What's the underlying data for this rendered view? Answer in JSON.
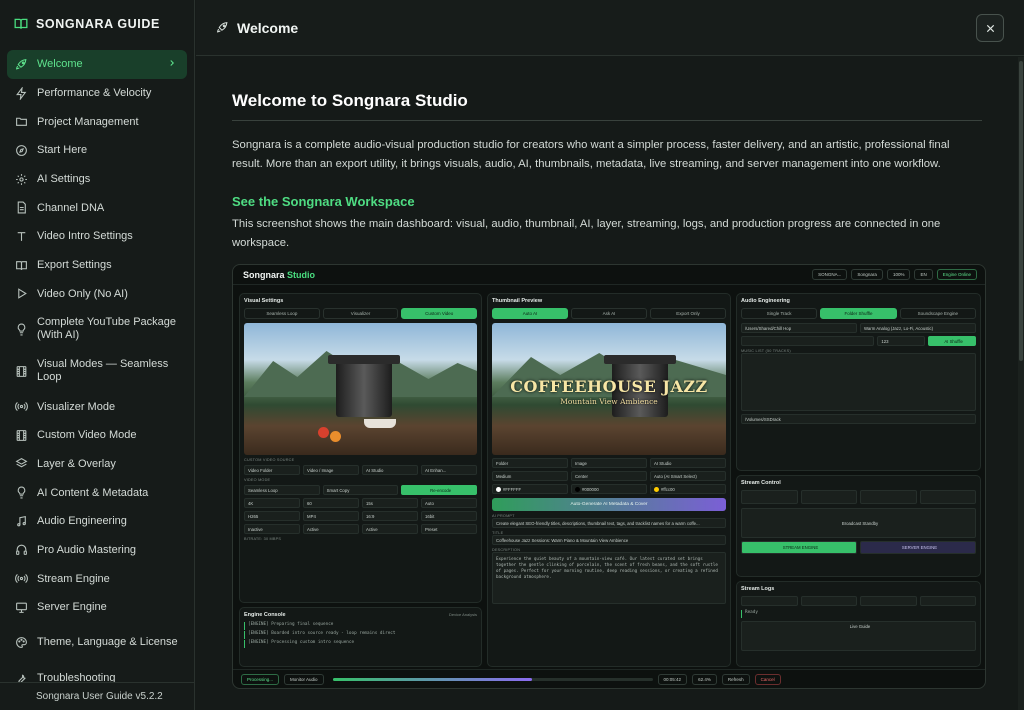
{
  "brand": {
    "title": "SONGNARA GUIDE"
  },
  "nav": [
    {
      "label": "Welcome",
      "icon": "rocket-icon",
      "active": true
    },
    {
      "label": "Performance & Velocity",
      "icon": "bolt-icon"
    },
    {
      "label": "Project Management",
      "icon": "folder-icon"
    },
    {
      "label": "Start Here",
      "icon": "compass-icon"
    },
    {
      "label": "AI Settings",
      "icon": "gear-icon"
    },
    {
      "label": "Channel DNA",
      "icon": "document-icon"
    },
    {
      "label": "Video Intro Settings",
      "icon": "text-icon"
    },
    {
      "label": "Export Settings",
      "icon": "book-icon"
    },
    {
      "label": "Video Only (No AI)",
      "icon": "play-icon"
    },
    {
      "label": "Complete YouTube Package (With AI)",
      "icon": "lightbulb-icon"
    },
    {
      "label": "Visual Modes — Seamless Loop",
      "icon": "film-icon"
    },
    {
      "label": "Visualizer Mode",
      "icon": "radio-icon"
    },
    {
      "label": "Custom Video Mode",
      "icon": "film-icon"
    },
    {
      "label": "Layer & Overlay",
      "icon": "layers-icon"
    },
    {
      "label": "AI Content & Metadata",
      "icon": "lightbulb-icon"
    },
    {
      "label": "Audio Engineering",
      "icon": "music-icon"
    },
    {
      "label": "Pro Audio Mastering",
      "icon": "headphones-icon"
    },
    {
      "label": "Stream Engine",
      "icon": "radio-icon"
    },
    {
      "label": "Server Engine",
      "icon": "monitor-icon"
    },
    {
      "label": "Theme, Language & License",
      "icon": "palette-icon"
    },
    {
      "label": "Troubleshooting",
      "icon": "wrench-icon"
    }
  ],
  "version": "Songnara User Guide v5.2.2",
  "header": {
    "title": "Welcome"
  },
  "content": {
    "title": "Welcome to Songnara Studio",
    "intro": "Songnara is a complete audio-visual production studio for creators who want a simpler process, faster delivery, and an artistic, professional final result. More than an export utility, it brings visuals, audio, AI, thumbnails, metadata, live streaming, and server management into one workflow.",
    "workspace_heading": "See the Songnara Workspace",
    "workspace_caption": "This screenshot shows the main dashboard: visual, audio, thumbnail, AI, layer, streaming, logs, and production progress are connected in one workspace."
  },
  "shot": {
    "logo_a": "Songnara",
    "logo_b": "Studio",
    "top_pills": [
      "SONGNA...",
      "Songnara",
      "100%",
      "EN",
      "Engine Online"
    ],
    "visual": {
      "title": "Visual Settings",
      "tabs": [
        "Seamless Loop",
        "Visualizer",
        "Custom Video"
      ],
      "source_label": "CUSTOM VIDEO SOURCE",
      "source_buttons": [
        "Video Folder",
        "Video / Image",
        "AI Studio",
        "AI Enhan..."
      ],
      "mode_label": "VIDEO MODE",
      "mode_buttons": [
        "Seamless Loop",
        "Smart Copy",
        "Re-encode"
      ],
      "rows": [
        [
          "4K",
          "60",
          "15s",
          "Auto"
        ],
        [
          "H265",
          "MP4",
          "16:9",
          "16bit"
        ],
        [
          "Inactive",
          "Active",
          "Active",
          "Preset"
        ]
      ],
      "bitrate": "BITRATE: 30 MBPS"
    },
    "console": {
      "title": "Engine Console",
      "button": "Device Analysis",
      "lines": [
        "[ENGINE] Preparing final sequence",
        "[ENGINE] Boarded intro source ready - loop remains direct",
        "[ENGINE] Processing custom intro sequence"
      ]
    },
    "thumb": {
      "title": "Thumbnail Preview",
      "tabs": [
        "Auto AI",
        "Ask AI",
        "Export Only"
      ],
      "headline": "COFFEEHOUSE JAZZ",
      "subline": "Mountain View Ambience",
      "source_buttons": [
        "Folder",
        "Image",
        "AI Studio"
      ],
      "fields": [
        "Medium",
        "Center",
        "Auto (AI Smart Select)"
      ],
      "colors": [
        "#FFFFFF",
        "#000000",
        "#ffcc00"
      ],
      "generate": "Auto-Generate AI Metadata & Cover",
      "ai_prompt_label": "AI PROMPT",
      "ai_prompt": "Create elegant SEO-friendly titles, descriptions, thumbnail text, tags, and tracklist names for a warm coffe...",
      "title_label": "TITLE",
      "title_value": "Coffeehouse Jazz Sessions: Warm Piano & Mountain View Ambience",
      "desc_label": "DESCRIPTION",
      "desc_value": "Experience the quiet beauty of a mountain-view café. Our latest curated set brings together the gentle clinking of porcelain, the scent of fresh beans, and the soft rustle of pages. Perfect for your morning routine, deep reading sessions, or creating a refined background atmosphere."
    },
    "audio": {
      "title": "Audio Engineering",
      "tabs": [
        "Single Track",
        "Folder Shuffle",
        "Soundscape Engine"
      ],
      "source": "/Users/Shared/Chill Hop",
      "mastering": "Warm Analog (Jazz, Lo-Fi, Acoustic)",
      "duration": "123",
      "music_list_label": "MUSIC LIST (50 TRACKS)",
      "output": "/Volumes/SSDrack"
    },
    "stream": {
      "title": "Stream Control",
      "standby": "Broadcast Standby",
      "buttons": [
        "STREAM ENGINE",
        "SERVER ENGINE"
      ]
    },
    "logs": {
      "title": "Stream Logs",
      "status": "Ready",
      "guide": "Live Guide"
    },
    "bottom": {
      "processing": "Processing...",
      "monitor": "Monitor Audio",
      "time_a": "00:05:42",
      "time_b": "62.4%",
      "refresh": "Refresh",
      "cancel": "Cancel"
    }
  }
}
